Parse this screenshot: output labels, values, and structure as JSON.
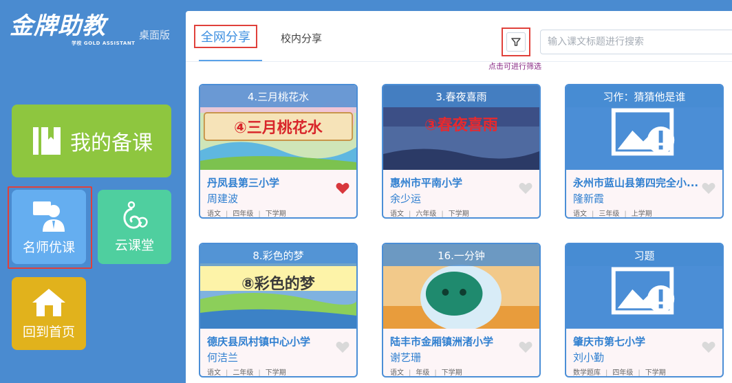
{
  "app": {
    "logo_text": "金牌助教",
    "logo_subtext": "学校 GOLD ASSISTANT",
    "edition": "桌面版"
  },
  "sidebar": {
    "my_prep": "我的备课",
    "famous_teacher": "名师优课",
    "cloud_class": "云课堂",
    "home": "回到首页"
  },
  "tabs": {
    "all_share": "全网分享",
    "school_share": "校内分享"
  },
  "filter": {
    "hint": "点击可进行筛选"
  },
  "search": {
    "placeholder": "输入课文标题进行搜索"
  },
  "colors": {
    "accent": "#4a8bd0",
    "liked_heart": "#d8383d",
    "unliked_heart": "#d9d9d9",
    "highlight_box": "#e0403a"
  },
  "cards": [
    {
      "title": "4.三月桃花水",
      "banner": "④三月桃花水",
      "school": "丹凤县第三小学",
      "teacher": "周建波",
      "subject": "语文",
      "grade": "四年级",
      "term": "下学期",
      "liked": true
    },
    {
      "title": "3.春夜喜雨",
      "banner": "③春夜喜雨",
      "school": "惠州市平南小学",
      "teacher": "余少运",
      "subject": "语文",
      "grade": "六年级",
      "term": "下学期",
      "liked": false
    },
    {
      "title": "习作：猜猜他是谁",
      "banner": "",
      "school": "永州市蓝山县第四完全小...",
      "teacher": "隆新霞",
      "subject": "语文",
      "grade": "三年级",
      "term": "上学期",
      "liked": false
    },
    {
      "title": "8.彩色的梦",
      "banner": "⑧彩色的梦",
      "school": "德庆县凤村镇中心小学",
      "teacher": "何洁兰",
      "subject": "语文",
      "grade": "二年级",
      "term": "下学期",
      "liked": false
    },
    {
      "title": "16.一分钟",
      "banner": "",
      "school": "陆丰市金厢镇洲渚小学",
      "teacher": "谢艺珊",
      "subject": "语文",
      "grade": "年级",
      "term": "下学期",
      "liked": false
    },
    {
      "title": "习题",
      "banner": "",
      "school": "肇庆市第七小学",
      "teacher": "刘小勤",
      "subject": "数学题库",
      "grade": "四年级",
      "term": "下学期",
      "liked": false
    }
  ]
}
